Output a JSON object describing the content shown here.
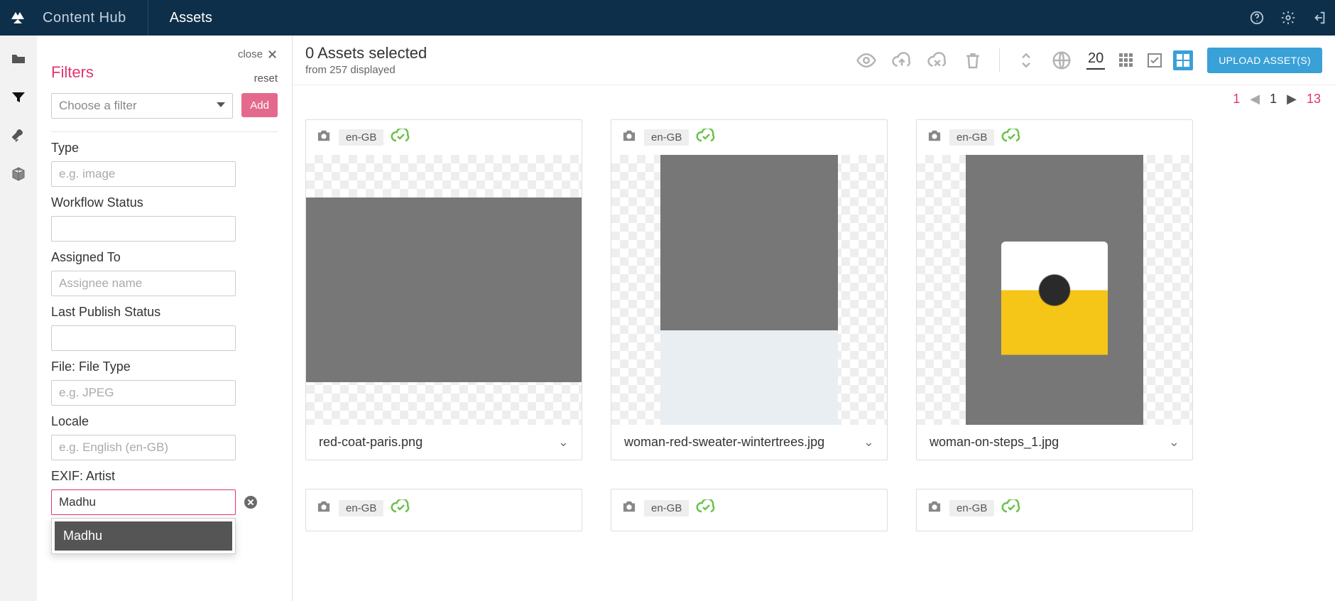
{
  "topbar": {
    "brand": "Content Hub",
    "nav_assets": "Assets"
  },
  "filters": {
    "close_label": "close",
    "title": "Filters",
    "reset_label": "reset",
    "choose_placeholder": "Choose a filter",
    "add_label": "Add",
    "type_label": "Type",
    "type_placeholder": "e.g. image",
    "workflow_label": "Workflow Status",
    "assigned_label": "Assigned To",
    "assigned_placeholder": "Assignee name",
    "last_publish_label": "Last Publish Status",
    "file_type_label": "File: File Type",
    "file_type_placeholder": "e.g. JPEG",
    "locale_label": "Locale",
    "locale_placeholder": "e.g. English (en-GB)",
    "exif_artist_label": "EXIF: Artist",
    "exif_artist_value": "Madhu",
    "dropdown_option": "Madhu"
  },
  "toolbar": {
    "selected_line": "0 Assets selected",
    "displayed_line": "from 257 displayed",
    "page_size": "20",
    "upload_label": "UPLOAD ASSET(S)"
  },
  "pager": {
    "first": "1",
    "current": "1",
    "total": "13"
  },
  "cards": [
    {
      "locale": "en-GB",
      "name": "red-coat-paris.png"
    },
    {
      "locale": "en-GB",
      "name": "woman-red-sweater-wintertrees.jpg"
    },
    {
      "locale": "en-GB",
      "name": "woman-on-steps_1.jpg"
    },
    {
      "locale": "en-GB",
      "name": ""
    },
    {
      "locale": "en-GB",
      "name": ""
    },
    {
      "locale": "en-GB",
      "name": ""
    }
  ]
}
